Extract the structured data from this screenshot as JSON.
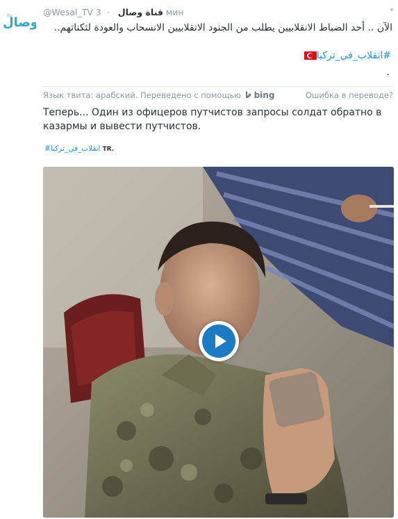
{
  "account": {
    "handle": "@Wesal_TV",
    "display_name": "قناة وصال",
    "timestamp": "3 мин",
    "avatar_text": "وصال",
    "avatar_small_text": "Tv"
  },
  "tweet": {
    "original_text": "الآن .. أحد الضباط الانقلابيين يطلب من الجنود الانقلابيين الانسحاب والعودة لثكناتهم..",
    "original_hashtag": "#انقلاب_في_تركيا",
    "original_trailing": ".",
    "flag_emoji": "turkey-flag-icon"
  },
  "translation": {
    "language_note": "Язык твита: арабский. Переведено с помощью",
    "provider": "bing",
    "error_link": "Ошибка в переводе?",
    "translated_text": "Теперь... Один из офицеров путчистов запросы солдат обратно в казармы и вывести путчистов.",
    "translated_hashtag": "#انقلاب_في_تركيا",
    "translated_suffix": "TR."
  },
  "media": {
    "type": "video",
    "play_icon": "play-icon"
  },
  "colors": {
    "link": "#1b95e0",
    "text": "#292f33",
    "muted": "#8899a6",
    "play": "#1b7bc3",
    "brand": "#2aa7c9"
  }
}
